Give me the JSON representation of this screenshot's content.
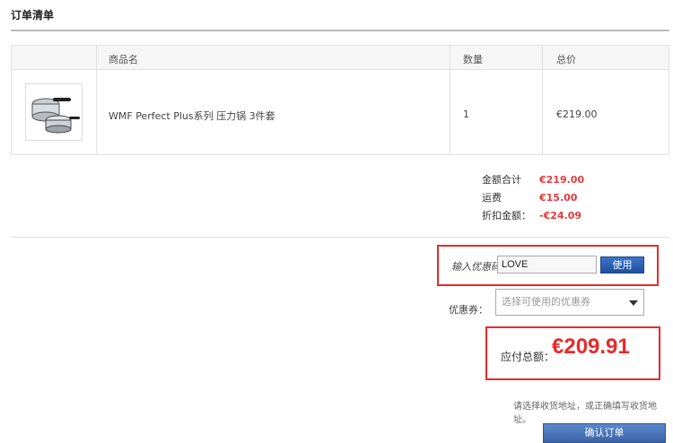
{
  "page": {
    "title": "订单清单"
  },
  "table": {
    "headers": {
      "name": "商品名",
      "qty": "数量",
      "total": "总价"
    },
    "row": {
      "image_icon": "pressure-cooker-set-image",
      "name": "WMF Perfect Plus系列 压力锅 3件套",
      "qty": "1",
      "total": "€219.00"
    }
  },
  "totals": {
    "subtotal_label": "金额合计",
    "subtotal_value": "€219.00",
    "shipping_label": "运费",
    "shipping_value": "€15.00",
    "discount_label": "折扣金额：",
    "discount_value": "-€24.09"
  },
  "promo": {
    "label": "输入优惠码",
    "value": "LOVE",
    "button": "使用"
  },
  "coupon": {
    "label": "优惠券：",
    "selected": "选择可使用的优惠券"
  },
  "payable": {
    "label": "应付总额：",
    "amount": "€209.91"
  },
  "note": "请选择收货地址，或正确填写收货地址。",
  "confirm_button": "确认订单",
  "colors": {
    "accent_red": "#e52b2b",
    "button_blue": "#2a5db0"
  }
}
